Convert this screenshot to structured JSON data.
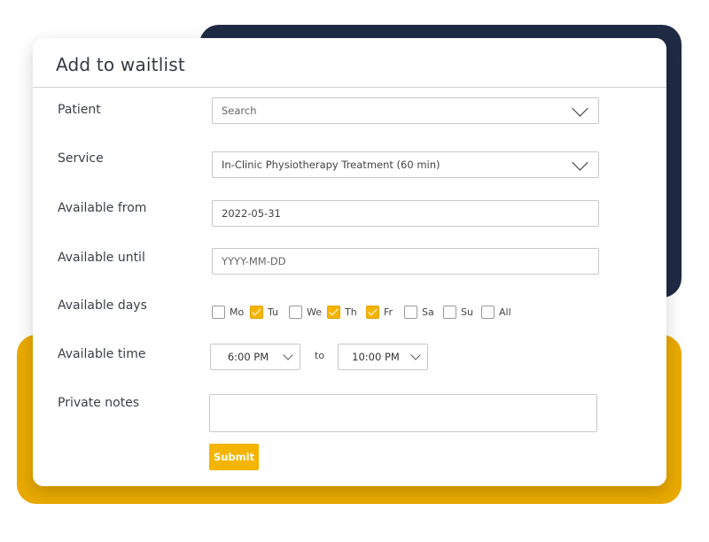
{
  "dialog": {
    "title": "Add to waitlist"
  },
  "form": {
    "patient": {
      "label": "Patient",
      "placeholder": "Search"
    },
    "service": {
      "label": "Service",
      "value": "In-Clinic Physiotherapy Treatment (60 min)"
    },
    "available_from": {
      "label": "Available from",
      "value": "2022-05-31"
    },
    "available_until": {
      "label": "Available until",
      "placeholder": "YYYY-MM-DD"
    },
    "available_days": {
      "label": "Available days",
      "days": [
        {
          "label": "Mo",
          "checked": false
        },
        {
          "label": "Tu",
          "checked": true
        },
        {
          "label": "We",
          "checked": false
        },
        {
          "label": "Th",
          "checked": true
        },
        {
          "label": "Fr",
          "checked": true
        },
        {
          "label": "Sa",
          "checked": false
        },
        {
          "label": "Su",
          "checked": false
        },
        {
          "label": "All",
          "checked": false
        }
      ]
    },
    "available_time": {
      "label": "Available time",
      "from": "6:00 PM",
      "separator": "to",
      "until": "10:00 PM"
    },
    "private_notes": {
      "label": "Private notes",
      "value": ""
    },
    "submit_label": "Submit"
  },
  "colors": {
    "accent": "#f4b400",
    "navy_backdrop": "#1f2a44",
    "gold_backdrop": "#e8a900"
  }
}
